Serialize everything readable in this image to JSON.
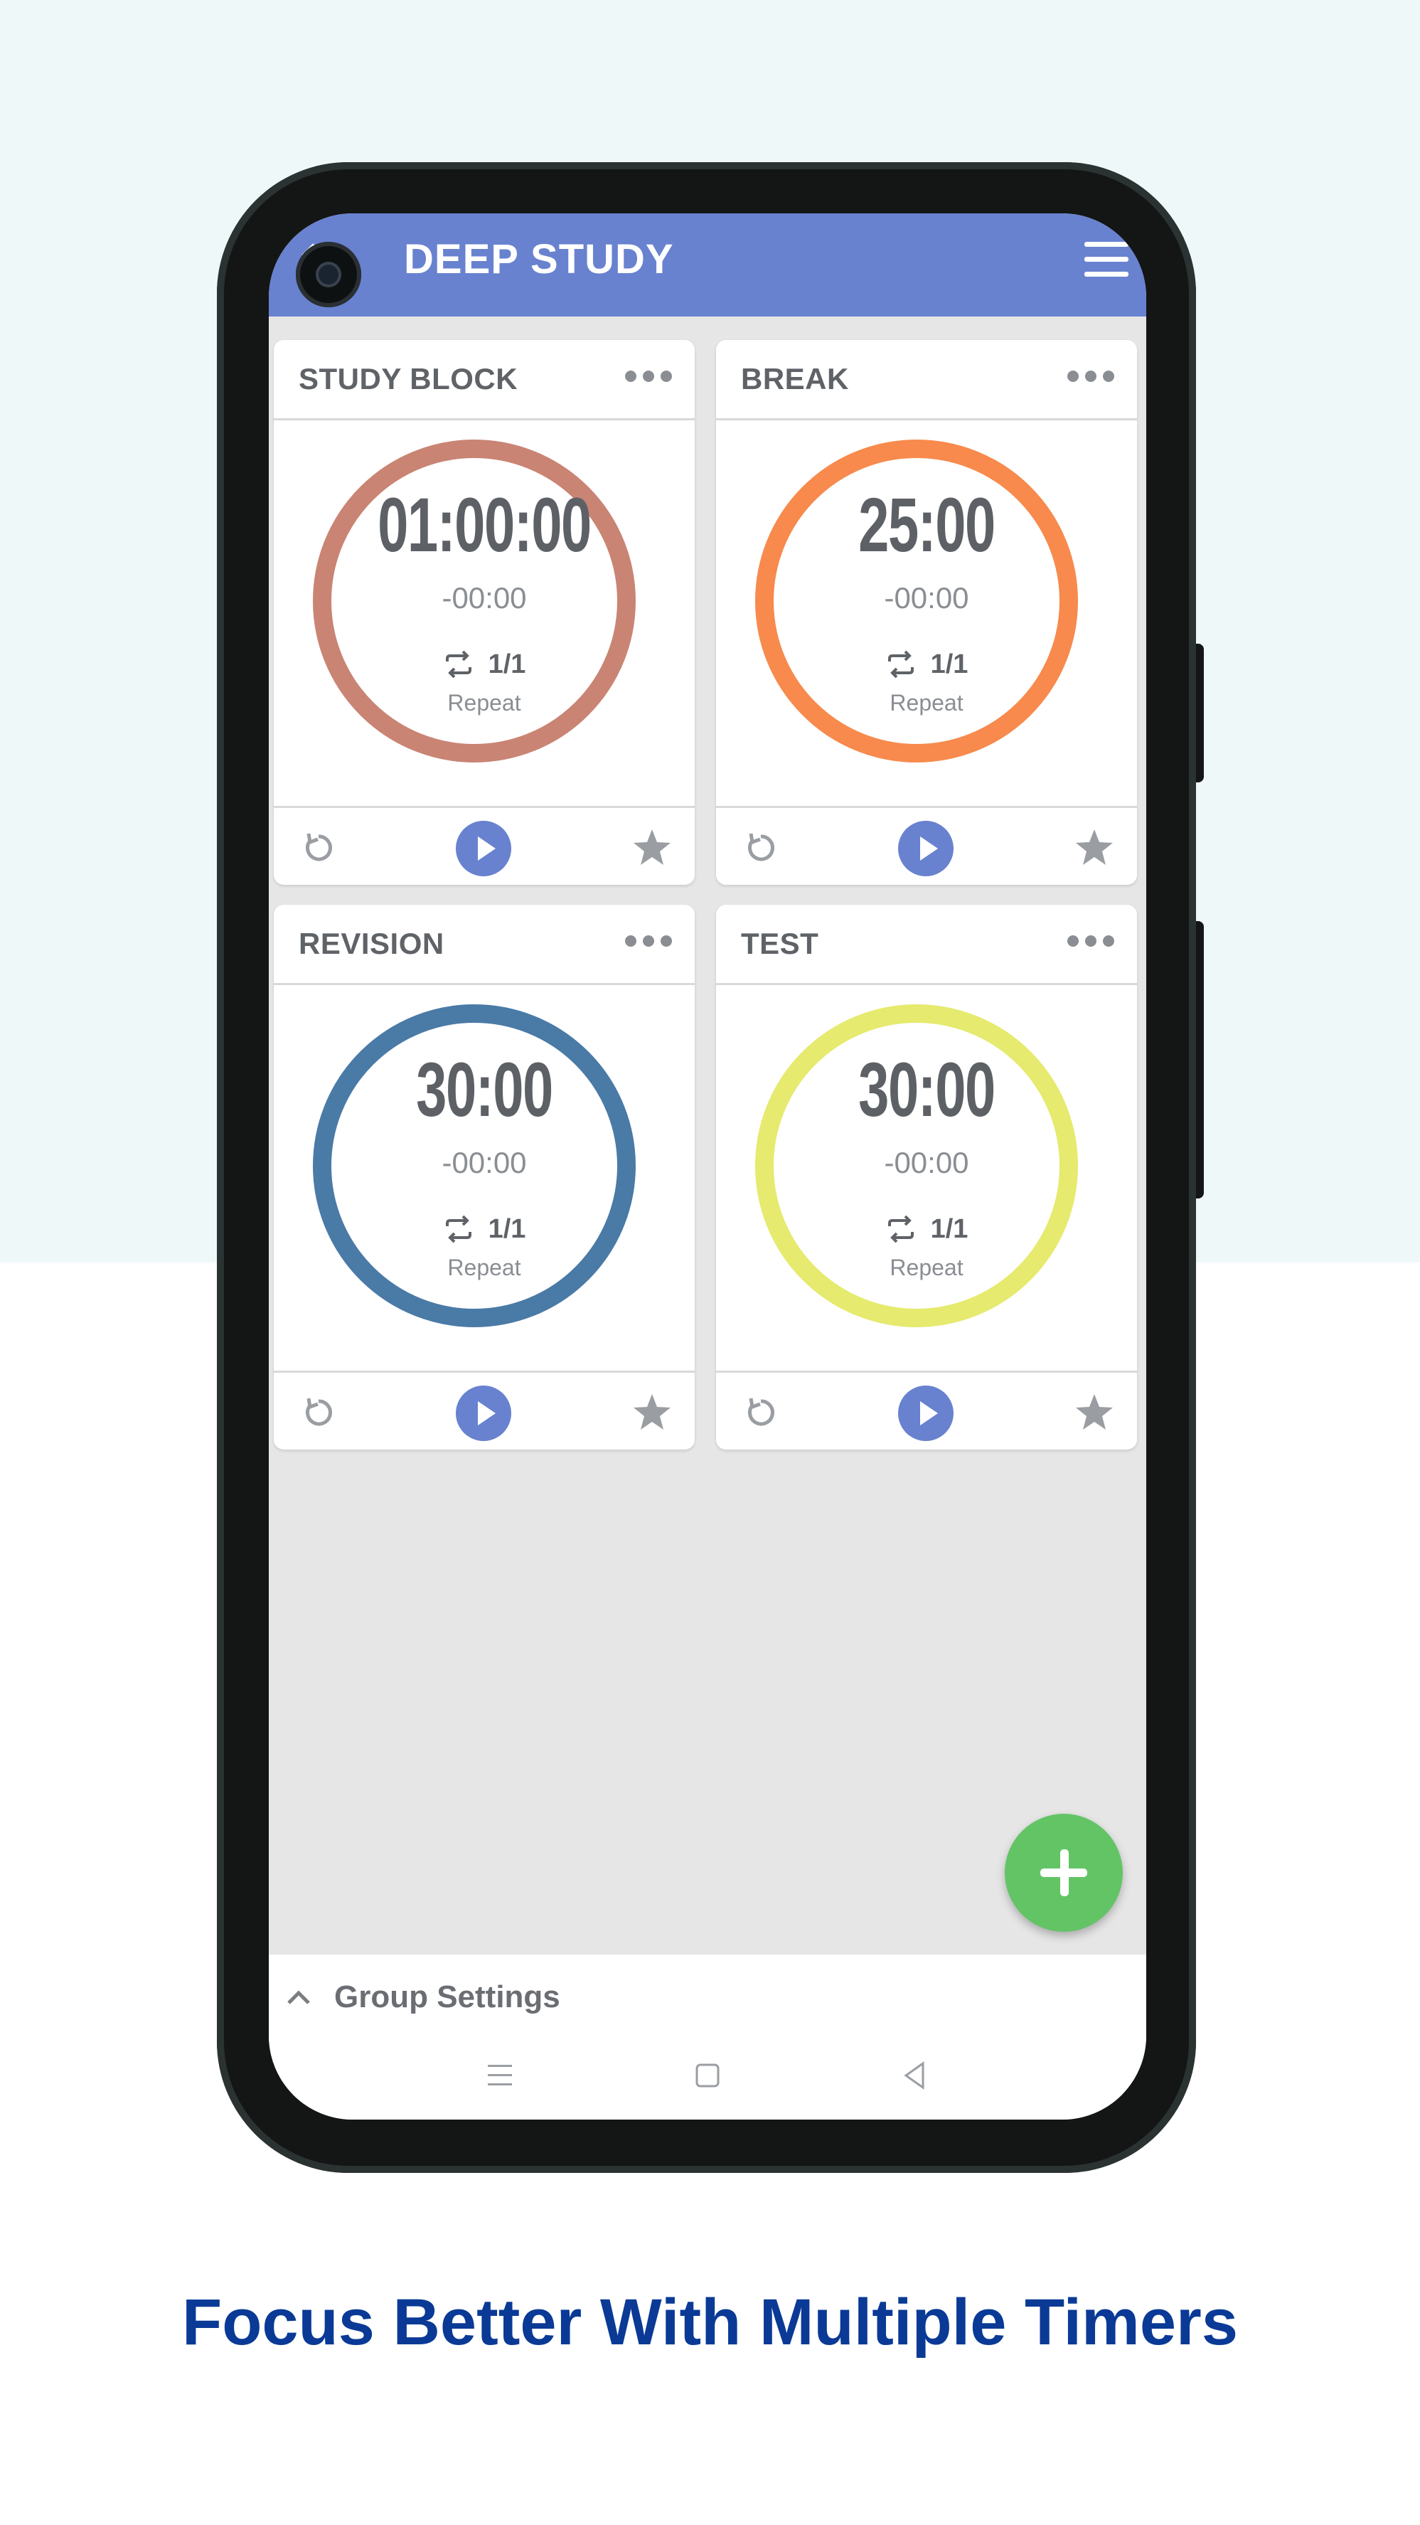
{
  "app": {
    "title": "DEEP STUDY"
  },
  "timers": [
    {
      "name": "STUDY BLOCK",
      "time": "01:00:00",
      "elapsed": "-00:00",
      "repeat_count": "1/1",
      "repeat_label": "Repeat",
      "color": "#c98474"
    },
    {
      "name": "BREAK",
      "time": "25:00",
      "elapsed": "-00:00",
      "repeat_count": "1/1",
      "repeat_label": "Repeat",
      "color": "#f78a4c"
    },
    {
      "name": "REVISION",
      "time": "30:00",
      "elapsed": "-00:00",
      "repeat_count": "1/1",
      "repeat_label": "Repeat",
      "color": "#4a7aa6"
    },
    {
      "name": "TEST",
      "time": "30:00",
      "elapsed": "-00:00",
      "repeat_count": "1/1",
      "repeat_label": "Repeat",
      "color": "#e6ea6e"
    }
  ],
  "bottom_sheet": {
    "label": "Group Settings"
  },
  "tagline": "Focus Better With Multiple Timers",
  "colors": {
    "accent": "#6882cf",
    "fab": "#63c466",
    "tagline": "#0a3a96",
    "top_background": "#eef8f8"
  },
  "icons": [
    "back-icon",
    "menu-icon",
    "more-icon",
    "repeat-icon",
    "reset-icon",
    "play-icon",
    "star-icon",
    "plus-icon",
    "chevron-up-icon",
    "nav-menu-icon",
    "nav-home-icon",
    "nav-back-icon"
  ]
}
